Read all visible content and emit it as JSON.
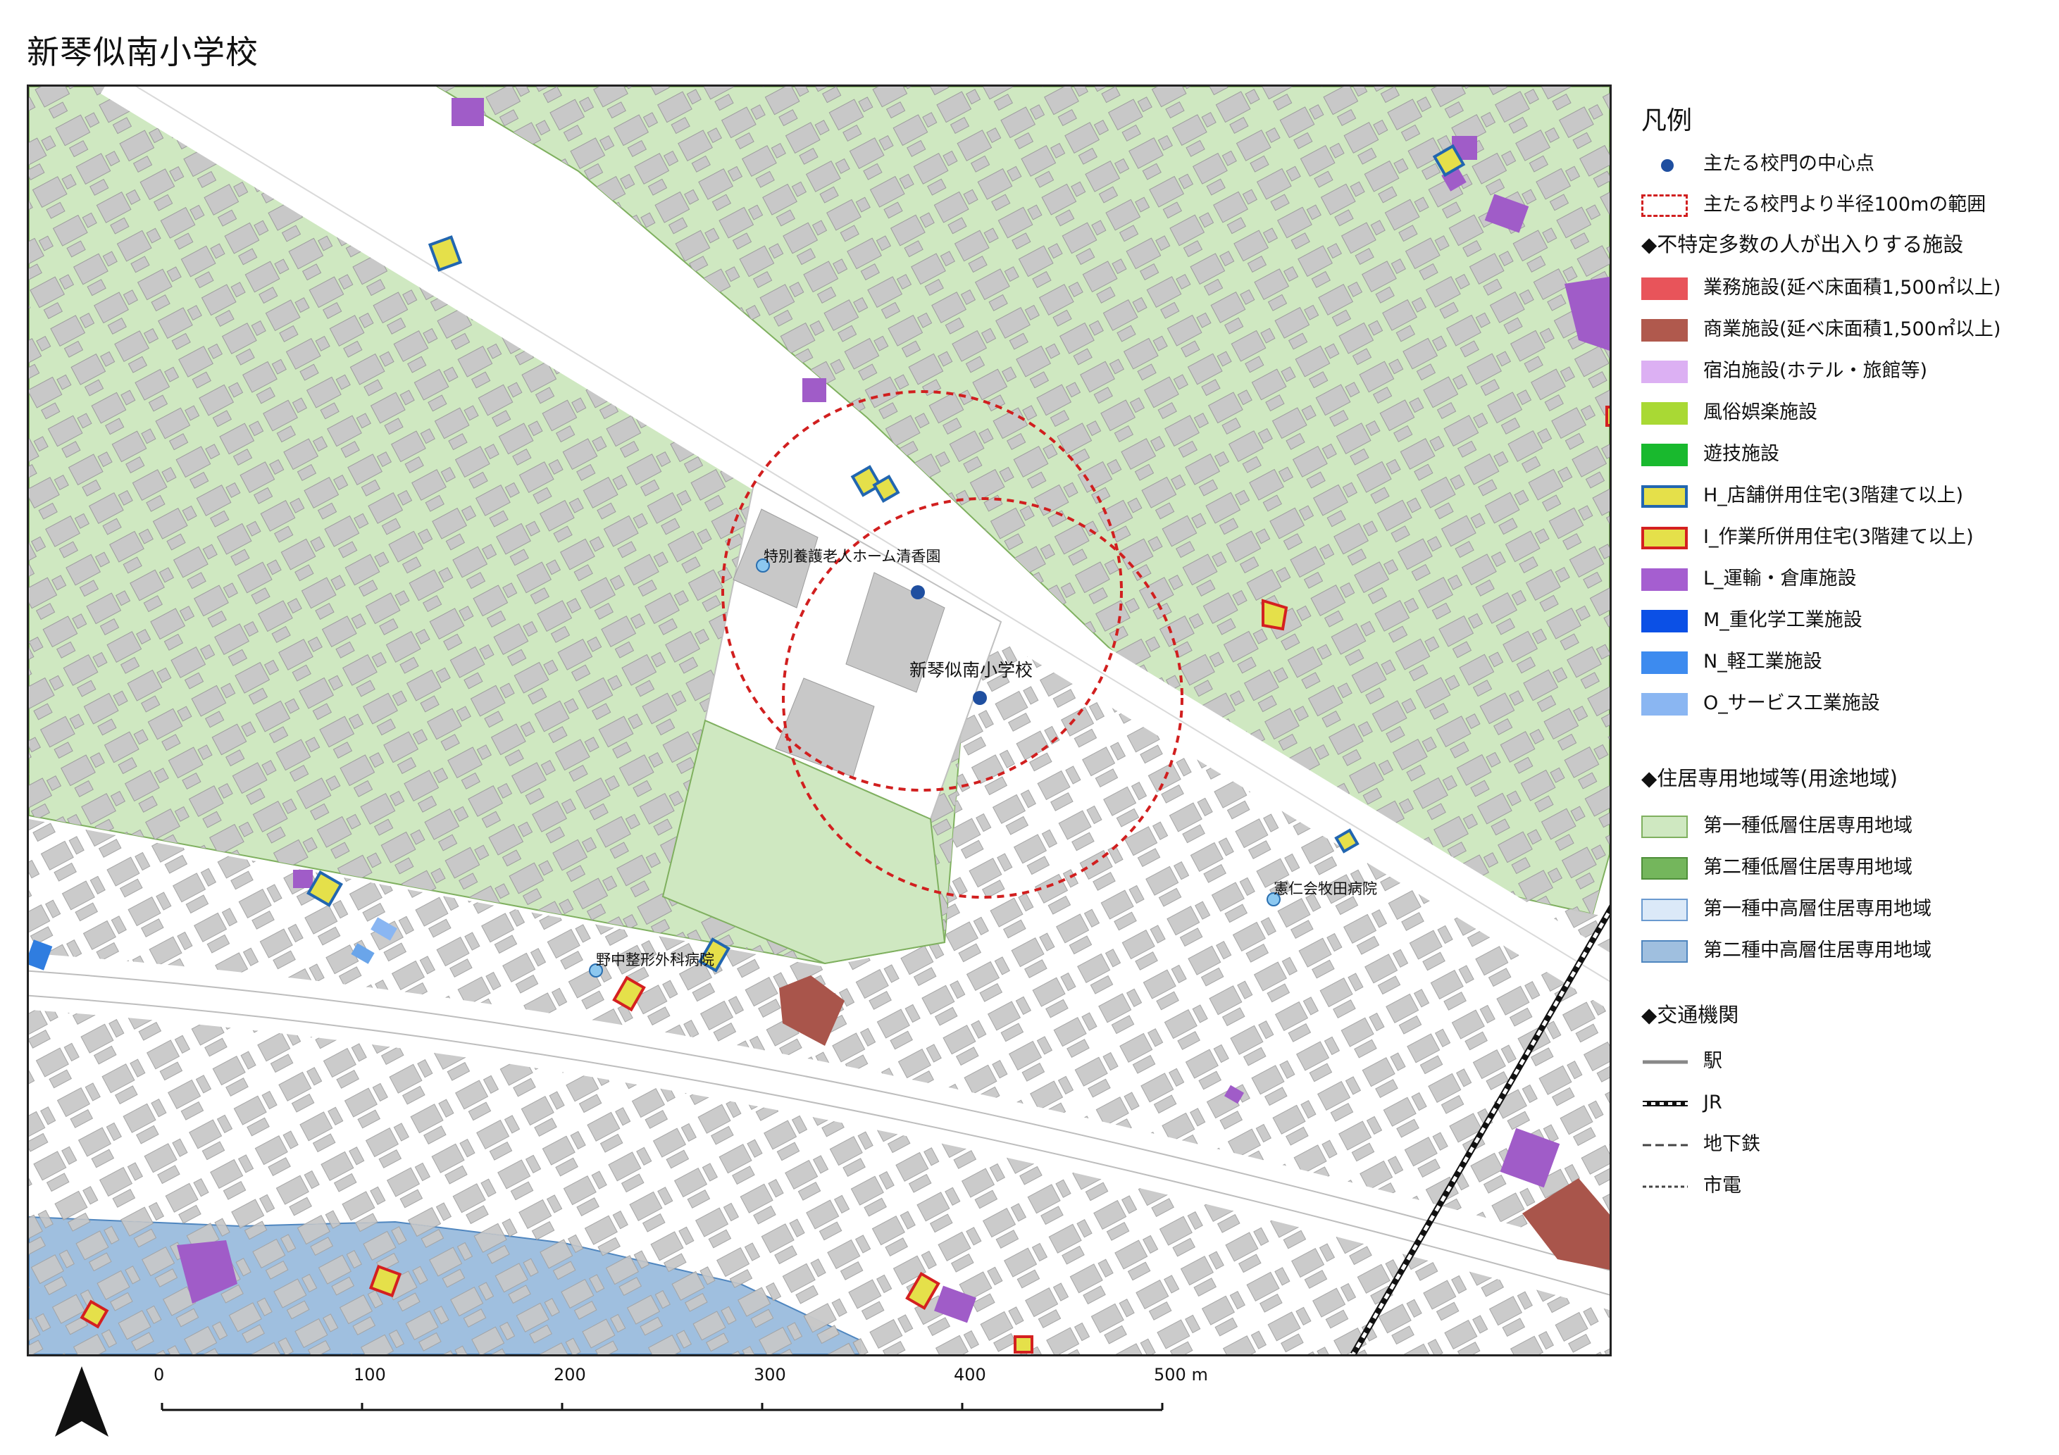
{
  "title": "新琴似南小学校",
  "map": {
    "labels": {
      "school": "新琴似南小学校",
      "nursing_home": "特別養護老人ホーム清香園",
      "hospital_makita": "憲仁会牧田病院",
      "hospital_nonaka": "野中整形外科病院"
    },
    "colors": {
      "low_rise_zone": "#cfe8c1",
      "mid_high_zone": "#9fbfdf",
      "building": "#c8c8c8",
      "road": "#ffffff",
      "school_gate": "#1f4fa0",
      "radius_circle": "#d11f1f",
      "logistics": "#a05cc8",
      "commercial": "#a9554b",
      "mixed_shop_fill": "#e5e04a",
      "mixed_shop_border": "#2266b0",
      "mixed_work_border": "#d42020"
    },
    "radius_m": 100
  },
  "legend": {
    "title": "凡例",
    "gate_point": "主たる校門の中心点",
    "radius_area": "主たる校門より半径100mの範囲",
    "section_facilities": "◆不特定多数の人が出入りする施設",
    "facilities": [
      {
        "label": "業務施設(延べ床面積1,500㎡以上)",
        "color": "#e8545a",
        "border": "#e8545a"
      },
      {
        "label": "商業施設(延べ床面積1,500㎡以上)",
        "color": "#b0594d",
        "border": "#b0594d"
      },
      {
        "label": "宿泊施設(ホテル・旅館等)",
        "color": "#dcb0f3",
        "border": "#dcb0f3"
      },
      {
        "label": "風俗娯楽施設",
        "color": "#a9d934",
        "border": "#a9d934"
      },
      {
        "label": "遊技施設",
        "color": "#19b92e",
        "border": "#19b92e"
      },
      {
        "label": "H_店舗併用住宅(3階建て以上)",
        "color": "#e5e04a",
        "border": "#2266b0"
      },
      {
        "label": "I_作業所併用住宅(3階建て以上)",
        "color": "#e5e04a",
        "border": "#d42020"
      },
      {
        "label": "L_運輸・倉庫施設",
        "color": "#a55ed0",
        "border": "#a55ed0"
      },
      {
        "label": "M_重化学工業施設",
        "color": "#0b50e6",
        "border": "#0b50e6"
      },
      {
        "label": "N_軽工業施設",
        "color": "#3d8bef",
        "border": "#3d8bef"
      },
      {
        "label": "O_サービス工業施設",
        "color": "#8ab6f2",
        "border": "#8ab6f2"
      }
    ],
    "section_zones": "◆住居専用地域等(用途地域)",
    "zones": [
      {
        "label": "第一種低層住居専用地域",
        "color": "#cfe8c1",
        "border": "#7fb05f"
      },
      {
        "label": "第二種低層住居専用地域",
        "color": "#74b65c",
        "border": "#4f8f3a"
      },
      {
        "label": "第一種中高層住居専用地域",
        "color": "#dbe9f8",
        "border": "#6a9ad0"
      },
      {
        "label": "第二種中高層住居専用地域",
        "color": "#9fbfdf",
        "border": "#4f86bf"
      }
    ],
    "section_transport": "◆交通機関",
    "transport": [
      {
        "label": "駅",
        "style": "solid"
      },
      {
        "label": "JR",
        "style": "rail"
      },
      {
        "label": "地下鉄",
        "style": "dashed"
      },
      {
        "label": "市電",
        "style": "dotted"
      }
    ]
  },
  "scale_bar": {
    "ticks": [
      "0",
      "100",
      "200",
      "300",
      "400",
      "500"
    ],
    "unit": "m"
  }
}
